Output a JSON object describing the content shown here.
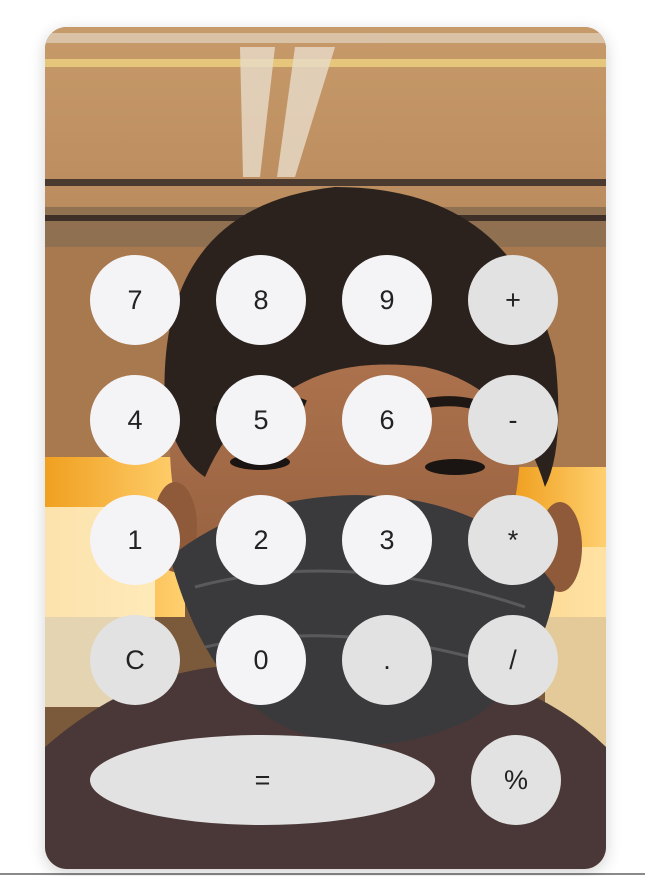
{
  "colors": {
    "number_key": "#f4f4f6",
    "operator_key": "#e2e2e2",
    "key_text": "#222222"
  },
  "background": {
    "description_icon": "selfie-photo"
  },
  "keypad": {
    "row1": [
      "7",
      "8",
      "9",
      "+"
    ],
    "row2": [
      "4",
      "5",
      "6",
      "-"
    ],
    "row3": [
      "1",
      "2",
      "3",
      "*"
    ],
    "row4": [
      "C",
      "0",
      ".",
      "/"
    ],
    "row5": [
      "=",
      "%"
    ]
  }
}
